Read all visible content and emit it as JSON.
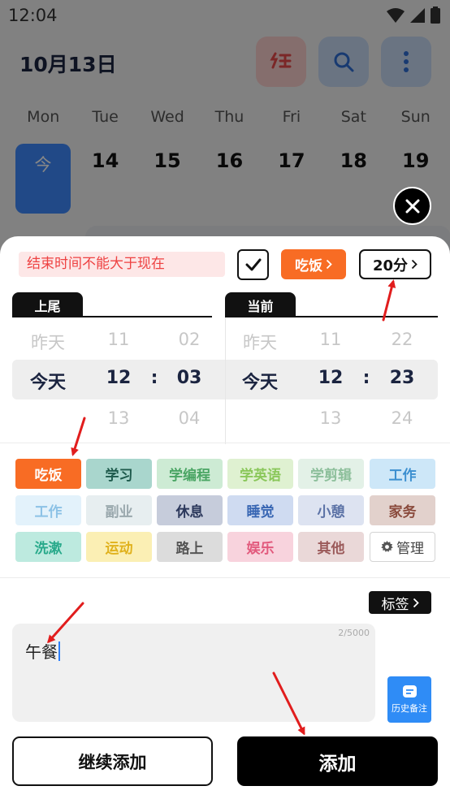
{
  "status_bar": {
    "time": "12:04"
  },
  "header": {
    "date_title": "10月13日"
  },
  "week": {
    "weekdays": [
      "Mon",
      "Tue",
      "Wed",
      "Thu",
      "Fri",
      "Sat",
      "Sun"
    ],
    "today_label": "今",
    "days": [
      "14",
      "15",
      "16",
      "17",
      "18",
      "19"
    ]
  },
  "sheet": {
    "warning": "结束时间不能大于现在",
    "category_label": "吃饭",
    "duration_label": "20分",
    "start_label": "上尾",
    "end_label": "当前",
    "start_picker": {
      "day": [
        "昨天",
        "今天",
        ""
      ],
      "hour": [
        "11",
        "12",
        "13"
      ],
      "minute": [
        "02",
        "03",
        "04"
      ]
    },
    "end_picker": {
      "day": [
        "昨天",
        "今天",
        ""
      ],
      "hour": [
        "11",
        "12",
        "13"
      ],
      "minute": [
        "22",
        "23",
        "24"
      ]
    },
    "tags": [
      {
        "label": "吃饭",
        "bg": "#f86c24",
        "fg": "#ffffff"
      },
      {
        "label": "学习",
        "bg": "#a9d6cd",
        "fg": "#1e5a4c"
      },
      {
        "label": "学编程",
        "bg": "#cdebd4",
        "fg": "#4aa564"
      },
      {
        "label": "学英语",
        "bg": "#dff1d1",
        "fg": "#8ac75a"
      },
      {
        "label": "学剪辑",
        "bg": "#e3f1e7",
        "fg": "#8dbf9b"
      },
      {
        "label": "工作",
        "bg": "#cde7f8",
        "fg": "#3b8fd0"
      },
      {
        "label": "工作",
        "bg": "#e3f2fb",
        "fg": "#8cc2e6"
      },
      {
        "label": "副业",
        "bg": "#e7eef0",
        "fg": "#9aa8ad"
      },
      {
        "label": "休息",
        "bg": "#c6ccdb",
        "fg": "#2b375b"
      },
      {
        "label": "睡觉",
        "bg": "#cfdbf1",
        "fg": "#3866b3"
      },
      {
        "label": "小憩",
        "bg": "#dde3f1",
        "fg": "#5b72a6"
      },
      {
        "label": "家务",
        "bg": "#e2d1cc",
        "fg": "#8a4a3c"
      },
      {
        "label": "洗漱",
        "bg": "#bdeadf",
        "fg": "#27a98a"
      },
      {
        "label": "运动",
        "bg": "#fbefb4",
        "fg": "#e0b11c"
      },
      {
        "label": "路上",
        "bg": "#dcdcdc",
        "fg": "#555555"
      },
      {
        "label": "娱乐",
        "bg": "#f8d3dd",
        "fg": "#e25a7d"
      },
      {
        "label": "其他",
        "bg": "#ead8d8",
        "fg": "#9b5a5a"
      },
      {
        "label": "管理",
        "bg": "#ffffff",
        "fg": "#444444"
      }
    ],
    "label_button": "标签",
    "note_text": "午餐",
    "note_count": "2/5000",
    "history_button": "历史备注",
    "continue_button": "继续添加",
    "add_button": "添加"
  },
  "colors": {
    "accent_orange": "#f86c24",
    "primary_blue": "#3f8bff",
    "warning_red": "#ee4242",
    "arrow_red": "#e11d1d"
  }
}
